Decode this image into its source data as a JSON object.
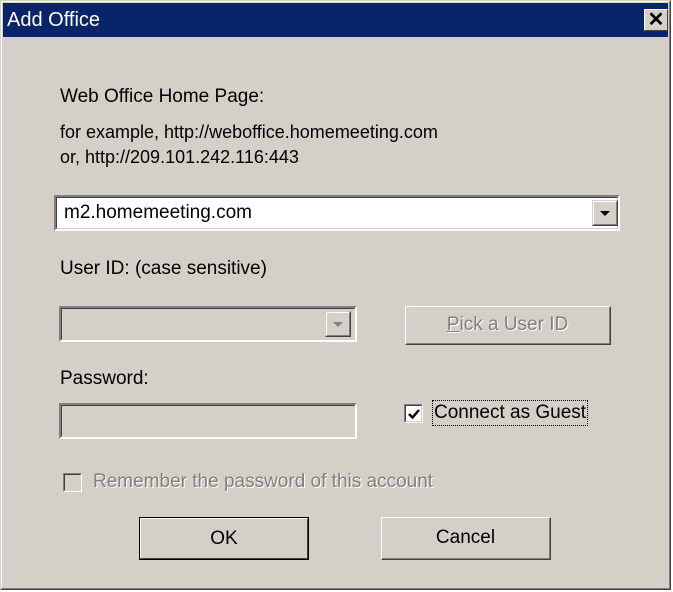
{
  "window": {
    "title": "Add Office",
    "close_glyph": "✕"
  },
  "home_page": {
    "label": "Web Office Home Page:",
    "example_line1": "for example, http://weboffice.homemeeting.com",
    "example_line2": "or, http://209.101.242.116:443",
    "value": "m2.homemeeting.com"
  },
  "user_id": {
    "label": "User ID: (case sensitive)",
    "value": "",
    "pick_button": "Pick a User ID",
    "enabled": false
  },
  "password": {
    "label": "Password:",
    "value": ""
  },
  "guest": {
    "label": "Connect as Guest",
    "checked": true
  },
  "remember": {
    "label": "Remember the password of this account",
    "checked": false,
    "enabled": false
  },
  "buttons": {
    "ok": "OK",
    "cancel": "Cancel"
  },
  "colors": {
    "face": "#d4d0c8",
    "titlebar": "#0a246a",
    "disabled_text": "#808080"
  }
}
